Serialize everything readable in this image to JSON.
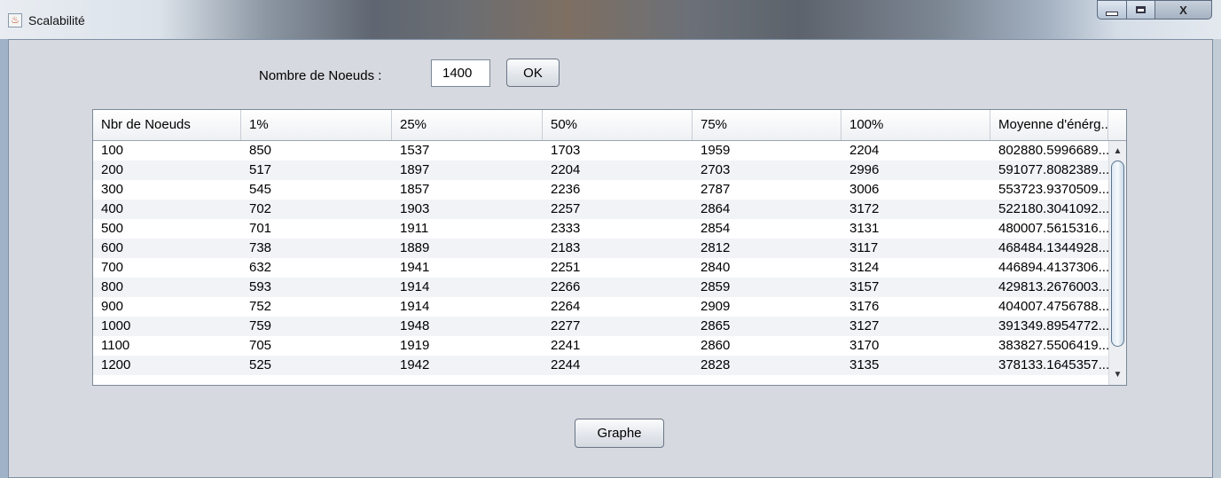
{
  "window": {
    "title": "Scalabilité",
    "controls": {
      "close": "X"
    }
  },
  "form": {
    "label": "Nombre de Noeuds :",
    "value": "1400",
    "ok_label": "OK"
  },
  "table": {
    "columns": [
      "Nbr de Noeuds",
      "1%",
      "25%",
      "50%",
      "75%",
      "100%",
      "Moyenne d'énérg..."
    ],
    "rows": [
      [
        "100",
        "850",
        "1537",
        "1703",
        "1959",
        "2204",
        "802880.5996689..."
      ],
      [
        "200",
        "517",
        "1897",
        "2204",
        "2703",
        "2996",
        "591077.8082389..."
      ],
      [
        "300",
        "545",
        "1857",
        "2236",
        "2787",
        "3006",
        "553723.9370509..."
      ],
      [
        "400",
        "702",
        "1903",
        "2257",
        "2864",
        "3172",
        "522180.3041092..."
      ],
      [
        "500",
        "701",
        "1911",
        "2333",
        "2854",
        "3131",
        "480007.5615316..."
      ],
      [
        "600",
        "738",
        "1889",
        "2183",
        "2812",
        "3117",
        "468484.1344928..."
      ],
      [
        "700",
        "632",
        "1941",
        "2251",
        "2840",
        "3124",
        "446894.4137306..."
      ],
      [
        "800",
        "593",
        "1914",
        "2266",
        "2859",
        "3157",
        "429813.2676003..."
      ],
      [
        "900",
        "752",
        "1914",
        "2264",
        "2909",
        "3176",
        "404007.4756788..."
      ],
      [
        "1000",
        "759",
        "1948",
        "2277",
        "2865",
        "3127",
        "391349.8954772..."
      ],
      [
        "1100",
        "705",
        "1919",
        "2241",
        "2860",
        "3170",
        "383827.5506419..."
      ],
      [
        "1200",
        "525",
        "1942",
        "2244",
        "2828",
        "3135",
        "378133.1645357..."
      ]
    ]
  },
  "graph_button_label": "Graphe"
}
